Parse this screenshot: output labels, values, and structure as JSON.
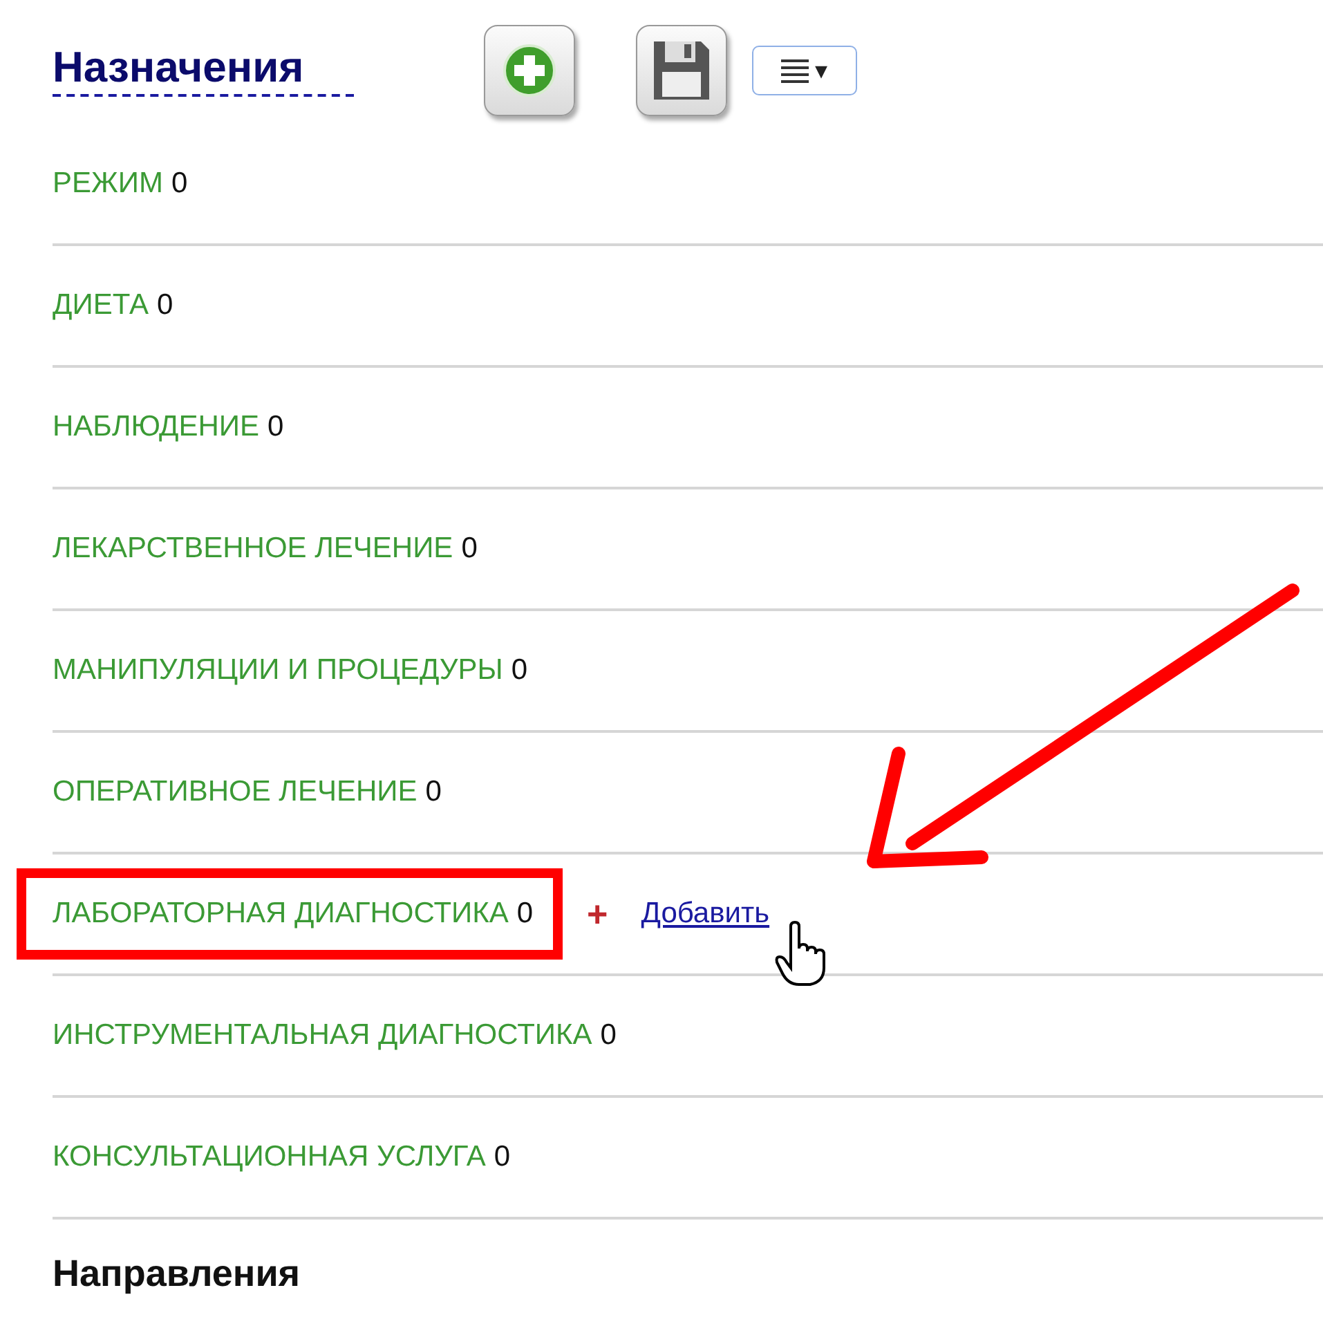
{
  "header": {
    "title": "Назначения",
    "menu_caret": "▾"
  },
  "rows": [
    {
      "label": "РЕЖИМ",
      "count": "0",
      "highlighted": false,
      "show_add": false
    },
    {
      "label": "ДИЕТА",
      "count": "0",
      "highlighted": false,
      "show_add": false
    },
    {
      "label": "НАБЛЮДЕНИЕ",
      "count": "0",
      "highlighted": false,
      "show_add": false
    },
    {
      "label": "ЛЕКАРСТВЕННОЕ ЛЕЧЕНИЕ",
      "count": "0",
      "highlighted": false,
      "show_add": false
    },
    {
      "label": "МАНИПУЛЯЦИИ И ПРОЦЕДУРЫ",
      "count": "0",
      "highlighted": false,
      "show_add": false
    },
    {
      "label": "ОПЕРАТИВНОЕ ЛЕЧЕНИЕ",
      "count": "0",
      "highlighted": false,
      "show_add": false
    },
    {
      "label": "ЛАБОРАТОРНАЯ ДИАГНОСТИКА",
      "count": "0",
      "highlighted": true,
      "show_add": true
    },
    {
      "label": "ИНСТРУМЕНТАЛЬНАЯ ДИАГНОСТИКА",
      "count": "0",
      "highlighted": false,
      "show_add": false
    },
    {
      "label": "КОНСУЛЬТАЦИОННАЯ УСЛУГА",
      "count": "0",
      "highlighted": false,
      "show_add": false
    }
  ],
  "add_action": {
    "plus": "+",
    "label": "Добавить"
  },
  "next_section": {
    "title": "Направления"
  }
}
